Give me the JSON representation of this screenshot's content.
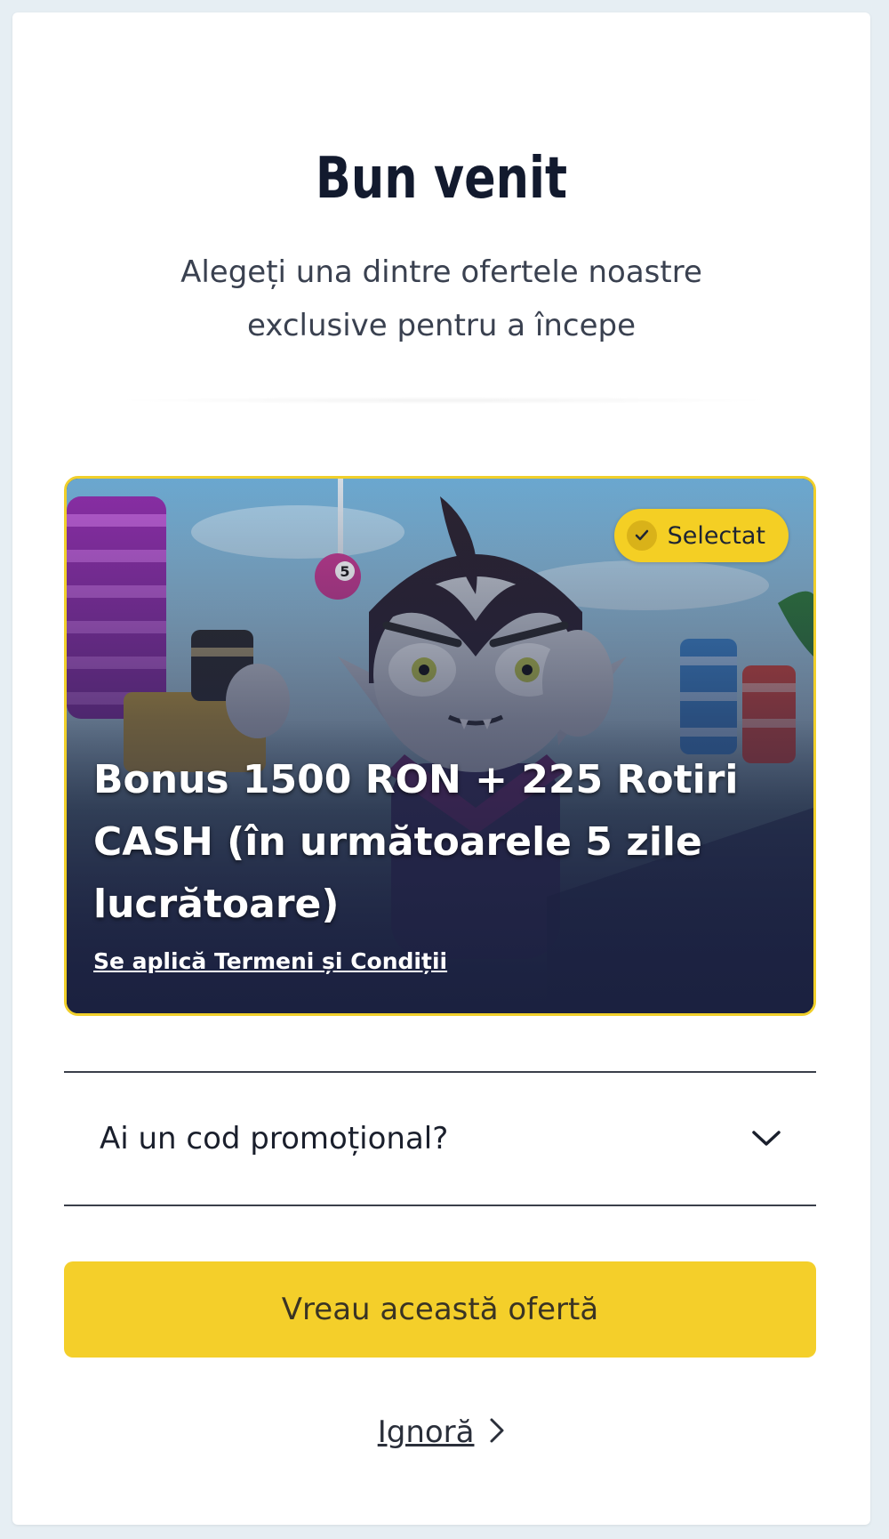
{
  "header": {
    "title": "Bun venit",
    "subtitle_line1": "Alegeți una dintre ofertele noastre",
    "subtitle_line2": "exclusive pentru a începe"
  },
  "offer": {
    "selected_label": "Selectat",
    "title_line1": "Bonus 1500 RON + 225 Rotiri",
    "title_line2": "CASH (în următoarele 5 zile",
    "title_line3": "lucrătoare)",
    "terms_link": "Se aplică Termeni și Condiții",
    "bingo_ball_number": "5"
  },
  "promo": {
    "label": "Ai un cod promoțional?",
    "icon": "chevron-down-icon"
  },
  "cta": {
    "label": "Vreau această ofertă"
  },
  "skip": {
    "label": "Ignoră",
    "icon": "chevron-right-icon"
  },
  "colors": {
    "accent_yellow": "#f4cf2a",
    "text_dark": "#121a2e",
    "card_dark": "#202746"
  }
}
